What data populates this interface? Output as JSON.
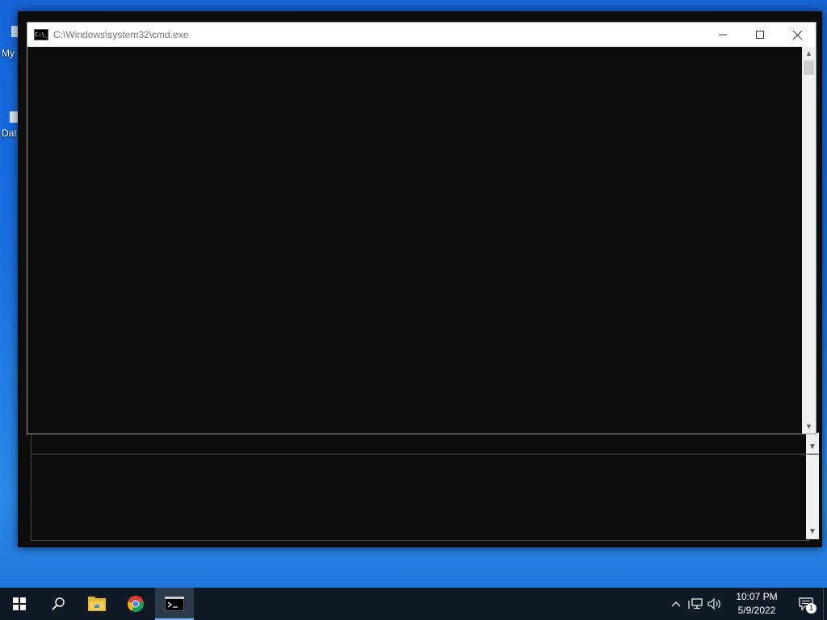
{
  "desktop": {
    "icons": [
      {
        "label": "My"
      },
      {
        "label": "Dat"
      }
    ]
  },
  "cmd_window": {
    "title": "C:\\Windows\\system32\\cmd.exe",
    "icon_text": "C:\\_"
  },
  "taskbar": {
    "icons": [
      "windows-start-icon",
      "search-icon",
      "file-explorer-icon",
      "chrome-icon",
      "cmd-icon"
    ],
    "clock_time": "10:07 PM",
    "clock_date": "5/9/2022",
    "notification_count": "1"
  }
}
